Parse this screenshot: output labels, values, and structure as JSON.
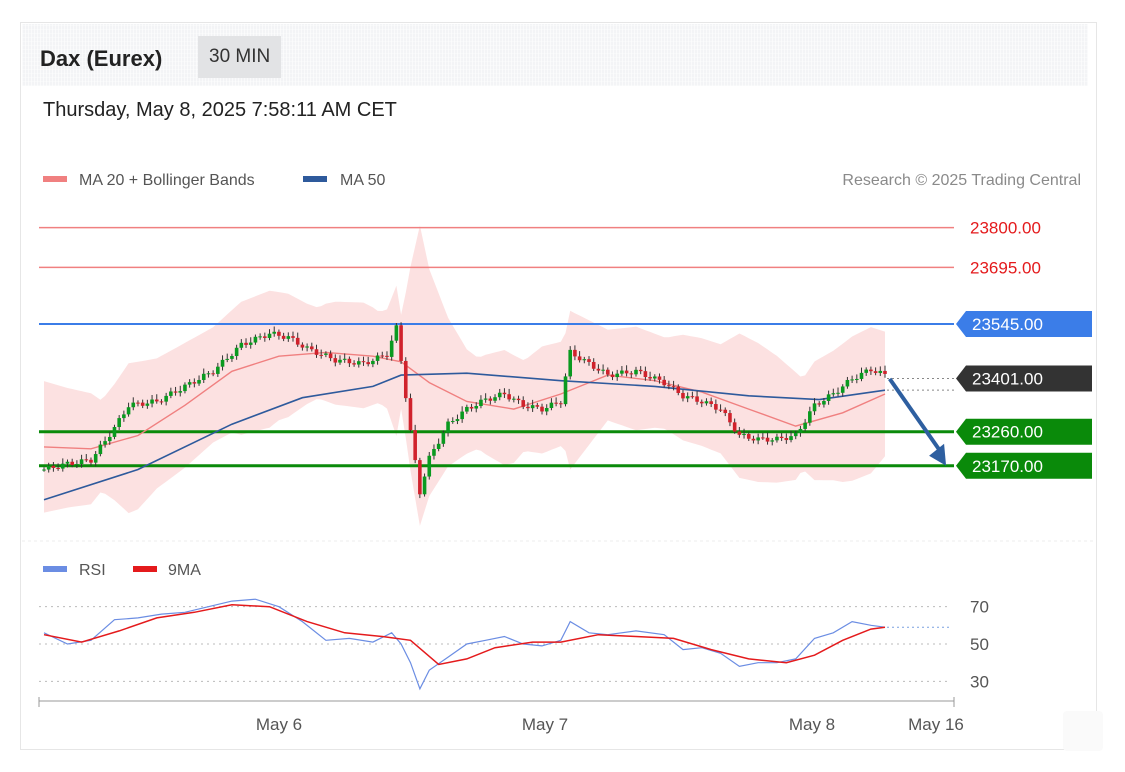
{
  "header": {
    "title": "Dax (Eurex)",
    "timeframe": "30 MIN",
    "datetime": "Thursday, May 8, 2025 7:58:11 AM CET"
  },
  "legend_main": [
    {
      "label": "MA 20 + Bollinger Bands",
      "color": "#f08080"
    },
    {
      "label": "MA 50",
      "color": "#2e5a9c"
    }
  ],
  "copyright": "Research © 2025 Trading Central",
  "legend_rsi": [
    {
      "label": "RSI",
      "color": "#6b8de3"
    },
    {
      "label": "9MA",
      "color": "#e41a1c"
    }
  ],
  "colors": {
    "resistance": "#f08080",
    "pivot": "#3b7de8",
    "support": "#0a8a0a",
    "last_price": "#333333",
    "bull_candle": "#0a9a20",
    "bear_candle": "#d0222c",
    "bb_fill": "#fcdcdc",
    "arrow": "#2e5fa0"
  },
  "chart_data": [
    {
      "type": "candlestick",
      "title": "Dax (Eurex)",
      "timeframe": "30 MIN",
      "x_tick_labels": [
        "May 6",
        "May 7",
        "May 8",
        "May 16"
      ],
      "ylim": [
        23000,
        23860
      ],
      "levels": [
        {
          "value": 23800.0,
          "label": "23800.00",
          "role": "resistance"
        },
        {
          "value": 23695.0,
          "label": "23695.00",
          "role": "resistance"
        },
        {
          "value": 23545.0,
          "label": "23545.00",
          "role": "pivot"
        },
        {
          "value": 23401.0,
          "label": "23401.00",
          "role": "last"
        },
        {
          "value": 23260.0,
          "label": "23260.00",
          "role": "support"
        },
        {
          "value": 23170.0,
          "label": "23170.00",
          "role": "support"
        }
      ],
      "price_path": [
        {
          "t": 0,
          "p": 23160
        },
        {
          "t": 5,
          "p": 23175
        },
        {
          "t": 10,
          "p": 23185
        },
        {
          "t": 15,
          "p": 23270
        },
        {
          "t": 18,
          "p": 23330
        },
        {
          "t": 24,
          "p": 23340
        },
        {
          "t": 30,
          "p": 23380
        },
        {
          "t": 36,
          "p": 23420
        },
        {
          "t": 42,
          "p": 23490
        },
        {
          "t": 48,
          "p": 23520
        },
        {
          "t": 52,
          "p": 23510
        },
        {
          "t": 56,
          "p": 23480
        },
        {
          "t": 62,
          "p": 23450
        },
        {
          "t": 68,
          "p": 23440
        },
        {
          "t": 73,
          "p": 23465
        },
        {
          "t": 75,
          "p": 23535
        },
        {
          "t": 76,
          "p": 23450
        },
        {
          "t": 78,
          "p": 23260
        },
        {
          "t": 80,
          "p": 23100
        },
        {
          "t": 82,
          "p": 23190
        },
        {
          "t": 86,
          "p": 23280
        },
        {
          "t": 90,
          "p": 23320
        },
        {
          "t": 94,
          "p": 23345
        },
        {
          "t": 98,
          "p": 23360
        },
        {
          "t": 102,
          "p": 23330
        },
        {
          "t": 106,
          "p": 23320
        },
        {
          "t": 110,
          "p": 23340
        },
        {
          "t": 112,
          "p": 23470
        },
        {
          "t": 116,
          "p": 23440
        },
        {
          "t": 120,
          "p": 23410
        },
        {
          "t": 126,
          "p": 23420
        },
        {
          "t": 132,
          "p": 23390
        },
        {
          "t": 136,
          "p": 23355
        },
        {
          "t": 140,
          "p": 23340
        },
        {
          "t": 144,
          "p": 23320
        },
        {
          "t": 148,
          "p": 23250
        },
        {
          "t": 152,
          "p": 23240
        },
        {
          "t": 156,
          "p": 23240
        },
        {
          "t": 160,
          "p": 23250
        },
        {
          "t": 164,
          "p": 23330
        },
        {
          "t": 168,
          "p": 23360
        },
        {
          "t": 172,
          "p": 23400
        },
        {
          "t": 176,
          "p": 23425
        },
        {
          "t": 179,
          "p": 23410
        }
      ],
      "ma20": [
        {
          "t": 0,
          "p": 23220
        },
        {
          "t": 10,
          "p": 23215
        },
        {
          "t": 20,
          "p": 23250
        },
        {
          "t": 30,
          "p": 23330
        },
        {
          "t": 40,
          "p": 23420
        },
        {
          "t": 50,
          "p": 23460
        },
        {
          "t": 60,
          "p": 23470
        },
        {
          "t": 70,
          "p": 23460
        },
        {
          "t": 76,
          "p": 23445
        },
        {
          "t": 82,
          "p": 23390
        },
        {
          "t": 90,
          "p": 23340
        },
        {
          "t": 100,
          "p": 23320
        },
        {
          "t": 110,
          "p": 23360
        },
        {
          "t": 120,
          "p": 23410
        },
        {
          "t": 130,
          "p": 23395
        },
        {
          "t": 140,
          "p": 23365
        },
        {
          "t": 150,
          "p": 23320
        },
        {
          "t": 160,
          "p": 23275
        },
        {
          "t": 170,
          "p": 23310
        },
        {
          "t": 179,
          "p": 23360
        }
      ],
      "ma50": [
        {
          "t": 0,
          "p": 23080
        },
        {
          "t": 20,
          "p": 23160
        },
        {
          "t": 40,
          "p": 23280
        },
        {
          "t": 55,
          "p": 23350
        },
        {
          "t": 70,
          "p": 23380
        },
        {
          "t": 76,
          "p": 23410
        },
        {
          "t": 90,
          "p": 23415
        },
        {
          "t": 110,
          "p": 23395
        },
        {
          "t": 130,
          "p": 23380
        },
        {
          "t": 150,
          "p": 23355
        },
        {
          "t": 165,
          "p": 23345
        },
        {
          "t": 179,
          "p": 23370
        }
      ],
      "bollinger_width": 120,
      "forecast_arrow": {
        "from": {
          "t": 180,
          "p": 23400
        },
        "to": {
          "t": 192,
          "p": 23170
        }
      }
    },
    {
      "type": "line",
      "title": "RSI",
      "ylim": [
        20,
        80
      ],
      "y_ticks": [
        70,
        50,
        30
      ],
      "last_rsi": 59,
      "series": [
        {
          "name": "RSI",
          "points": [
            {
              "t": 0,
              "v": 56
            },
            {
              "t": 5,
              "v": 50
            },
            {
              "t": 10,
              "v": 52
            },
            {
              "t": 15,
              "v": 63
            },
            {
              "t": 20,
              "v": 64
            },
            {
              "t": 25,
              "v": 66
            },
            {
              "t": 30,
              "v": 67
            },
            {
              "t": 35,
              "v": 70
            },
            {
              "t": 40,
              "v": 73
            },
            {
              "t": 45,
              "v": 74
            },
            {
              "t": 50,
              "v": 70
            },
            {
              "t": 55,
              "v": 62
            },
            {
              "t": 60,
              "v": 52
            },
            {
              "t": 65,
              "v": 53
            },
            {
              "t": 70,
              "v": 51
            },
            {
              "t": 74,
              "v": 56
            },
            {
              "t": 76,
              "v": 50
            },
            {
              "t": 78,
              "v": 40
            },
            {
              "t": 80,
              "v": 26
            },
            {
              "t": 82,
              "v": 36
            },
            {
              "t": 86,
              "v": 43
            },
            {
              "t": 90,
              "v": 50
            },
            {
              "t": 94,
              "v": 52
            },
            {
              "t": 98,
              "v": 54
            },
            {
              "t": 102,
              "v": 50
            },
            {
              "t": 106,
              "v": 49
            },
            {
              "t": 110,
              "v": 52
            },
            {
              "t": 112,
              "v": 62
            },
            {
              "t": 116,
              "v": 56
            },
            {
              "t": 120,
              "v": 55
            },
            {
              "t": 126,
              "v": 57
            },
            {
              "t": 132,
              "v": 55
            },
            {
              "t": 136,
              "v": 47
            },
            {
              "t": 140,
              "v": 48
            },
            {
              "t": 144,
              "v": 45
            },
            {
              "t": 148,
              "v": 38
            },
            {
              "t": 152,
              "v": 40
            },
            {
              "t": 156,
              "v": 40
            },
            {
              "t": 160,
              "v": 42
            },
            {
              "t": 164,
              "v": 53
            },
            {
              "t": 168,
              "v": 56
            },
            {
              "t": 172,
              "v": 62
            },
            {
              "t": 176,
              "v": 60
            },
            {
              "t": 179,
              "v": 59
            }
          ]
        },
        {
          "name": "9MA",
          "points": [
            {
              "t": 0,
              "v": 55
            },
            {
              "t": 8,
              "v": 51
            },
            {
              "t": 16,
              "v": 57
            },
            {
              "t": 24,
              "v": 64
            },
            {
              "t": 32,
              "v": 67
            },
            {
              "t": 40,
              "v": 71
            },
            {
              "t": 48,
              "v": 70
            },
            {
              "t": 56,
              "v": 62
            },
            {
              "t": 64,
              "v": 56
            },
            {
              "t": 72,
              "v": 54
            },
            {
              "t": 78,
              "v": 52
            },
            {
              "t": 84,
              "v": 39
            },
            {
              "t": 90,
              "v": 42
            },
            {
              "t": 96,
              "v": 48
            },
            {
              "t": 104,
              "v": 51
            },
            {
              "t": 110,
              "v": 51
            },
            {
              "t": 118,
              "v": 55
            },
            {
              "t": 126,
              "v": 54
            },
            {
              "t": 134,
              "v": 53
            },
            {
              "t": 142,
              "v": 47
            },
            {
              "t": 150,
              "v": 42
            },
            {
              "t": 158,
              "v": 40
            },
            {
              "t": 164,
              "v": 44
            },
            {
              "t": 170,
              "v": 52
            },
            {
              "t": 176,
              "v": 58
            },
            {
              "t": 179,
              "v": 59
            }
          ]
        }
      ]
    }
  ]
}
